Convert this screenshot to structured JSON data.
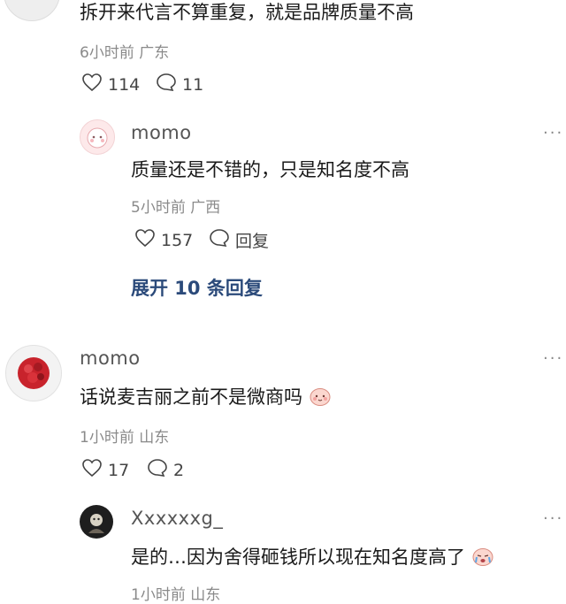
{
  "comment_top": {
    "text": "拆开来代言不算重复，就是品牌质量不高",
    "meta": "6小时前 广东",
    "likes": "114",
    "replies": "11"
  },
  "reply_1": {
    "username": "momo",
    "text": "质量还是不错的，只是知名度不高",
    "meta": "5小时前 广西",
    "likes": "157",
    "reply_label": "回复"
  },
  "expand_label": "展开 10 条回复",
  "comment_2": {
    "username": "momo",
    "text": "话说麦吉丽之前不是微商吗",
    "meta": "1小时前 山东",
    "likes": "17",
    "replies": "2"
  },
  "reply_2": {
    "username": "Xxxxxxg_",
    "text": "是的…因为舍得砸钱所以现在知名度高了",
    "meta": "1小时前 山东"
  },
  "more_glyph": "···"
}
